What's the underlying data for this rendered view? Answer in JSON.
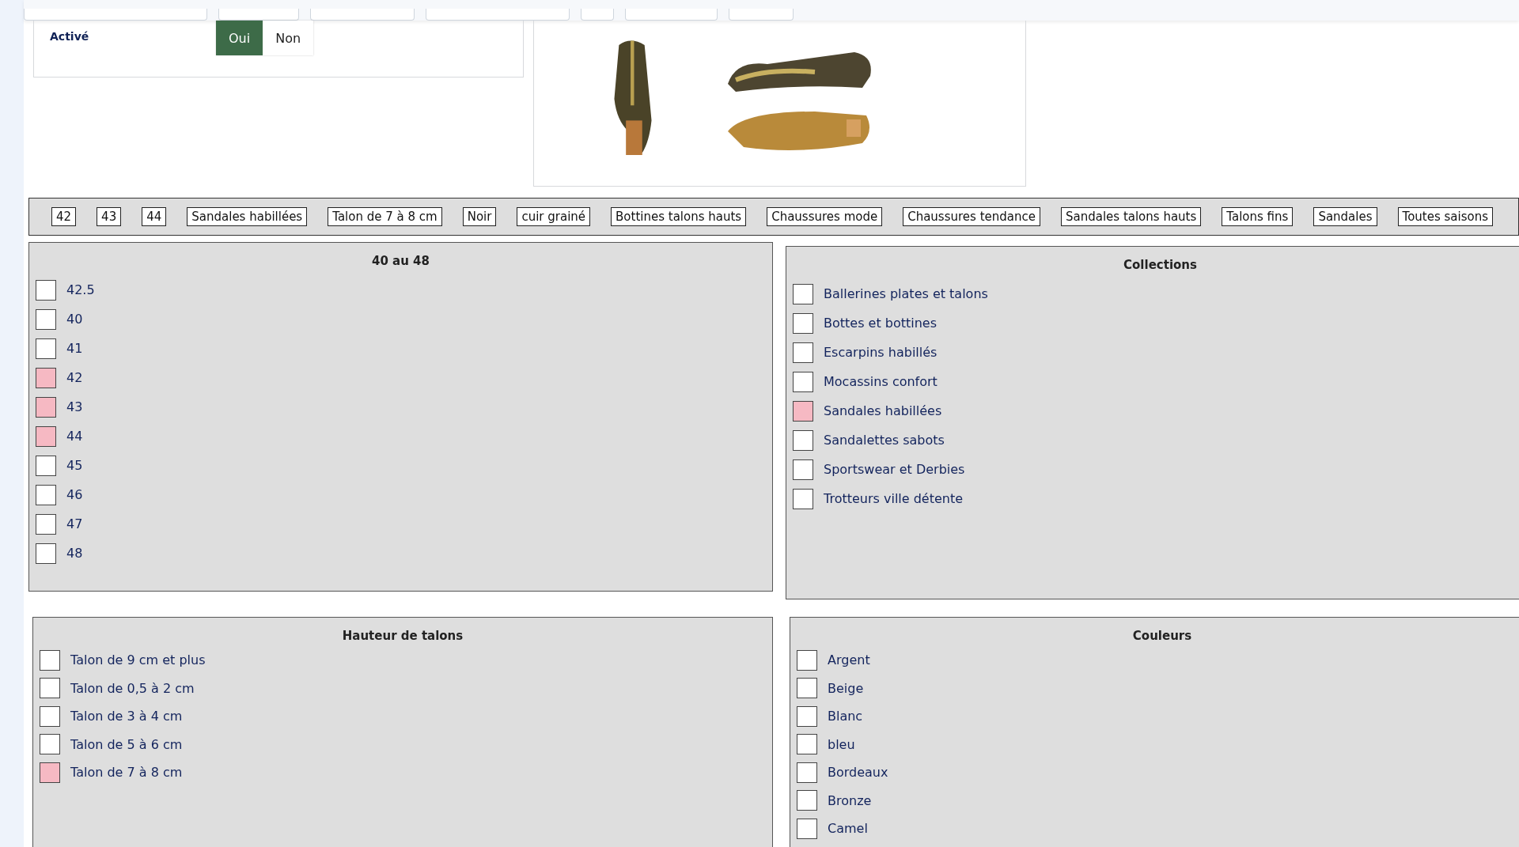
{
  "active_field": {
    "label": "Activé",
    "options": [
      {
        "label": "Oui",
        "selected": true
      },
      {
        "label": "Non",
        "selected": false
      }
    ]
  },
  "tags": [
    "42",
    "43",
    "44",
    "Sandales habillées",
    "Talon de 7 à 8 cm",
    "Noir",
    "cuir grainé",
    "Bottines talons hauts",
    "Chaussures mode",
    "Chaussures tendance",
    "Sandales talons hauts",
    "Talons fins",
    "Sandales",
    "Toutes saisons"
  ],
  "groups": [
    {
      "title": "40 au 48",
      "items": [
        {
          "label": "42.5",
          "checked": false
        },
        {
          "label": "40",
          "checked": false
        },
        {
          "label": "41",
          "checked": false
        },
        {
          "label": "42",
          "checked": true
        },
        {
          "label": "43",
          "checked": true
        },
        {
          "label": "44",
          "checked": true
        },
        {
          "label": "45",
          "checked": false
        },
        {
          "label": "46",
          "checked": false
        },
        {
          "label": "47",
          "checked": false
        },
        {
          "label": "48",
          "checked": false
        }
      ]
    },
    {
      "title": "Collections",
      "items": [
        {
          "label": "Ballerines plates et talons",
          "checked": false
        },
        {
          "label": "Bottes et bottines",
          "checked": false
        },
        {
          "label": "Escarpins habillés",
          "checked": false
        },
        {
          "label": "Mocassins confort",
          "checked": false
        },
        {
          "label": "Sandales habillées",
          "checked": true
        },
        {
          "label": "Sandalettes sabots",
          "checked": false
        },
        {
          "label": "Sportswear et Derbies",
          "checked": false
        },
        {
          "label": "Trotteurs ville détente",
          "checked": false
        }
      ]
    },
    {
      "title": "Hauteur de talons",
      "items": [
        {
          "label": "Talon de 9 cm et plus",
          "checked": false
        },
        {
          "label": "Talon de 0,5 à 2 cm",
          "checked": false
        },
        {
          "label": "Talon de 3 à 4 cm",
          "checked": false
        },
        {
          "label": "Talon de 5 à 6 cm",
          "checked": false
        },
        {
          "label": "Talon de 7 à 8 cm",
          "checked": true
        }
      ]
    },
    {
      "title": "Couleurs",
      "items": [
        {
          "label": "Argent",
          "checked": false
        },
        {
          "label": "Beige",
          "checked": false
        },
        {
          "label": "Blanc",
          "checked": false
        },
        {
          "label": "bleu",
          "checked": false
        },
        {
          "label": "Bordeaux",
          "checked": false
        },
        {
          "label": "Bronze",
          "checked": false
        },
        {
          "label": "Camel",
          "checked": false
        }
      ]
    }
  ]
}
